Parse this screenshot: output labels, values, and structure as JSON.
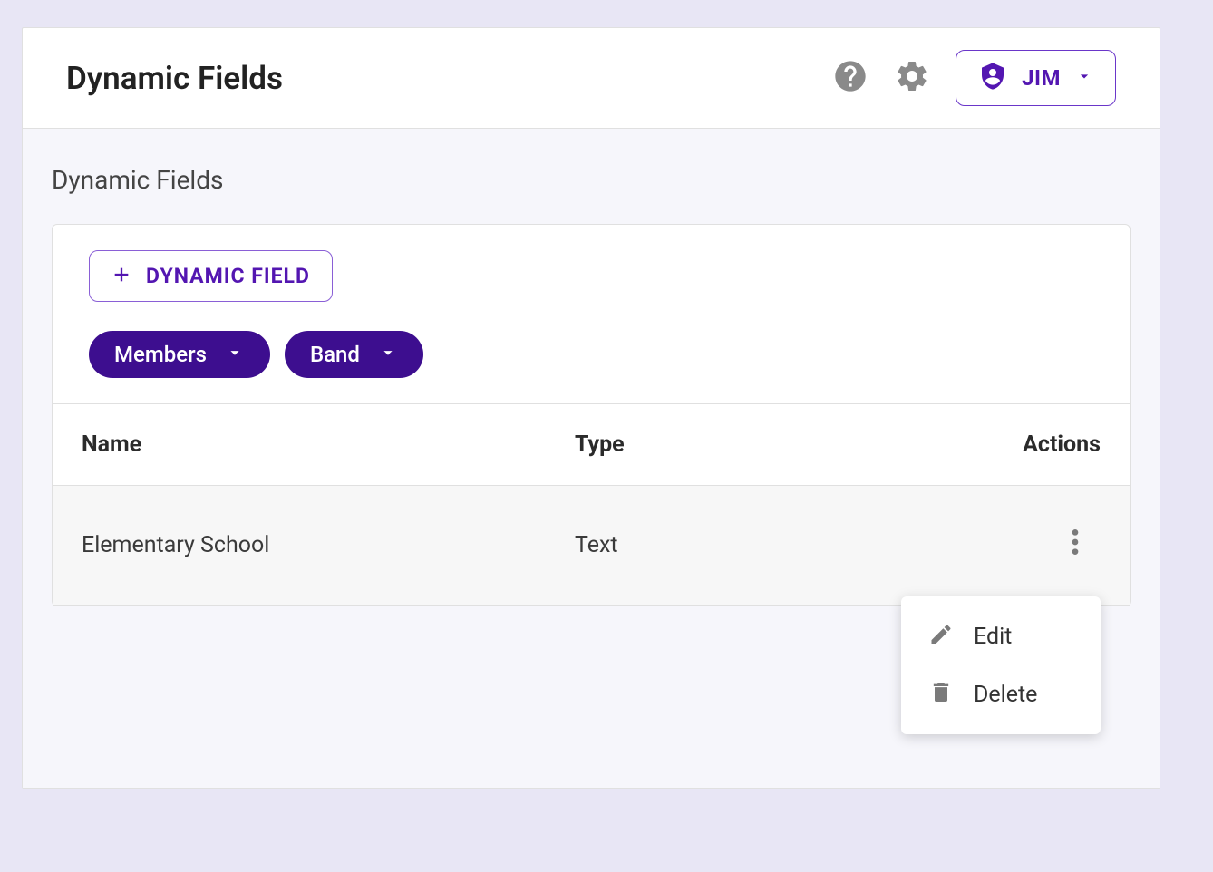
{
  "header": {
    "title": "Dynamic Fields",
    "user_name": "JIM"
  },
  "section": {
    "title": "Dynamic Fields"
  },
  "toolbar": {
    "add_label": "DYNAMIC FIELD"
  },
  "filters": {
    "chips": [
      {
        "label": "Members"
      },
      {
        "label": "Band"
      }
    ]
  },
  "table": {
    "columns": {
      "name": "Name",
      "type": "Type",
      "actions": "Actions"
    },
    "rows": [
      {
        "name": "Elementary School",
        "type": "Text"
      }
    ]
  },
  "actions_menu": {
    "edit": "Edit",
    "delete": "Delete"
  }
}
